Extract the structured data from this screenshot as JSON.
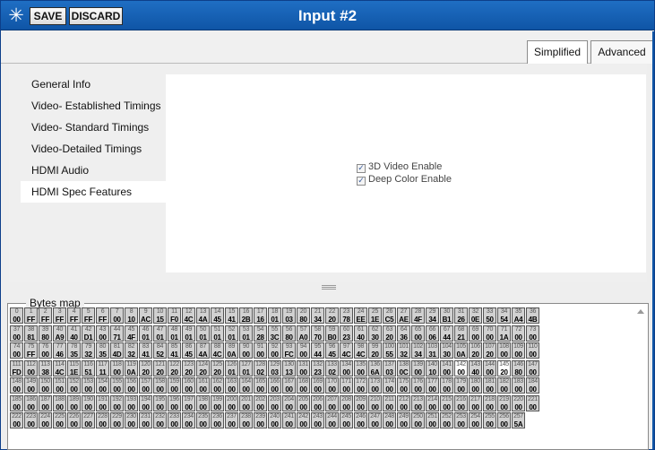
{
  "window": {
    "title": "Input #2",
    "logo_icon": "snowflake-icon",
    "logo_glyph": "✳",
    "save_label": "SAVE",
    "discard_label": "DISCARD",
    "accent_color": "#1661b5"
  },
  "tabs": [
    {
      "label": "Simplified",
      "selected": true
    },
    {
      "label": "Advanced",
      "selected": false
    }
  ],
  "nav": {
    "items": [
      {
        "label": "General Info",
        "selected": false
      },
      {
        "label": "Video- Established Timings",
        "selected": false
      },
      {
        "label": "Video- Standard Timings",
        "selected": false
      },
      {
        "label": "Video-Detailed Timings",
        "selected": false
      },
      {
        "label": "HDMI Audio",
        "selected": false
      },
      {
        "label": "HDMI Spec Features",
        "selected": true
      }
    ]
  },
  "content": {
    "checkboxes": [
      {
        "label": "3D Video Enable",
        "checked": true
      },
      {
        "label": "Deep Color Enable",
        "checked": true
      }
    ]
  },
  "bytes_map": {
    "legend": "Bytes map",
    "rows": [
      [
        "00",
        "FF",
        "FF",
        "FF",
        "FF",
        "FF",
        "FF",
        "00",
        "10",
        "AC",
        "15",
        "F0",
        "4C",
        "4A",
        "45",
        "41",
        "2B",
        "16",
        "01",
        "03",
        "80",
        "34",
        "20",
        "78",
        "EE",
        "1E",
        "C5",
        "AE",
        "4F",
        "34",
        "B1",
        "26",
        "0E",
        "50",
        "54",
        "A4",
        "4B"
      ],
      [
        "00",
        "81",
        "80",
        "A9",
        "40",
        "D1",
        "00",
        "71",
        "4F",
        "01",
        "01",
        "01",
        "01",
        "01",
        "01",
        "01",
        "01",
        "28",
        "3C",
        "80",
        "A0",
        "70",
        "B0",
        "23",
        "40",
        "30",
        "20",
        "36",
        "00",
        "06",
        "44",
        "21",
        "00",
        "00",
        "1A",
        "00",
        "00"
      ],
      [
        "00",
        "FF",
        "00",
        "46",
        "35",
        "32",
        "35",
        "4D",
        "32",
        "41",
        "52",
        "41",
        "45",
        "4A",
        "4C",
        "0A",
        "00",
        "00",
        "00",
        "FC",
        "00",
        "44",
        "45",
        "4C",
        "4C",
        "20",
        "55",
        "32",
        "34",
        "31",
        "30",
        "0A",
        "20",
        "20",
        "00",
        "00",
        "00"
      ],
      [
        "FD",
        "00",
        "38",
        "4C",
        "1E",
        "51",
        "11",
        "00",
        "0A",
        "20",
        "20",
        "20",
        "20",
        "20",
        "20",
        "01",
        "01",
        "02",
        "03",
        "13",
        "00",
        "23",
        "02",
        "00",
        "00",
        "6A",
        "03",
        "0C",
        "00",
        "10",
        "00",
        "00",
        "40",
        "00",
        "20",
        "80",
        "00"
      ],
      [
        "00",
        "00",
        "00",
        "00",
        "00",
        "00",
        "00",
        "00",
        "00",
        "00",
        "00",
        "00",
        "00",
        "00",
        "00",
        "00",
        "00",
        "00",
        "00",
        "00",
        "00",
        "00",
        "00",
        "00",
        "00",
        "00",
        "00",
        "00",
        "00",
        "00",
        "00",
        "00",
        "00",
        "00",
        "00",
        "00",
        "00"
      ],
      [
        "00",
        "00",
        "00",
        "00",
        "00",
        "00",
        "00",
        "00",
        "00",
        "00",
        "00",
        "00",
        "00",
        "00",
        "00",
        "00",
        "00",
        "00",
        "00",
        "00",
        "00",
        "00",
        "00",
        "00",
        "00",
        "00",
        "00",
        "00",
        "00",
        "00",
        "00",
        "00",
        "00",
        "00",
        "00",
        "00",
        "00"
      ],
      [
        "00",
        "00",
        "00",
        "00",
        "00",
        "00",
        "00",
        "00",
        "00",
        "00",
        "00",
        "00",
        "00",
        "00",
        "00",
        "00",
        "00",
        "00",
        "00",
        "00",
        "00",
        "00",
        "00",
        "00",
        "00",
        "00",
        "00",
        "00",
        "00",
        "00",
        "00",
        "00",
        "00",
        "00",
        "00",
        "5A"
      ]
    ],
    "highlighted_indices": [
      142,
      145
    ]
  }
}
